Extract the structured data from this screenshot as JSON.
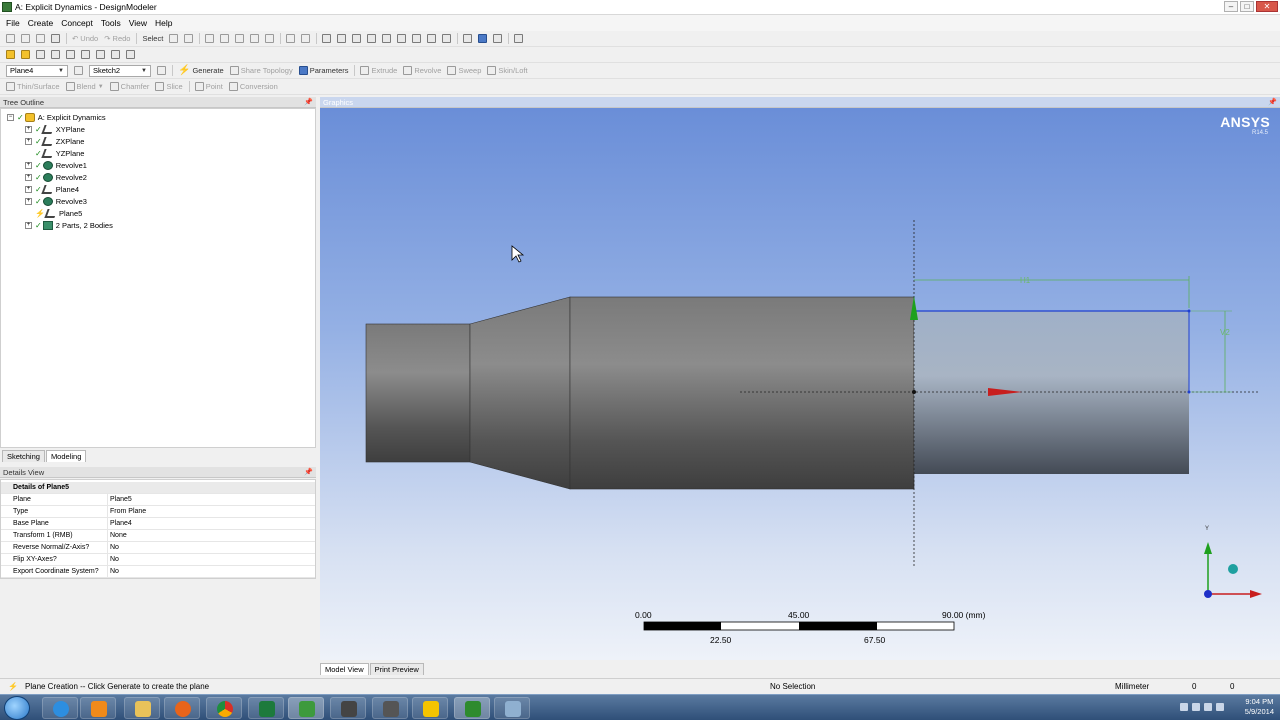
{
  "window": {
    "title": "A: Explicit Dynamics - DesignModeler"
  },
  "menu": [
    "File",
    "Create",
    "Concept",
    "Tools",
    "View",
    "Help"
  ],
  "toolbar1": {
    "undo": "Undo",
    "redo": "Redo",
    "select": "Select"
  },
  "toolbar3": {
    "plane_combo": "Plane4",
    "sketch_combo": "Sketch2",
    "generate": "Generate",
    "share_topology": "Share Topology",
    "parameters": "Parameters",
    "extrude": "Extrude",
    "revolve": "Revolve",
    "sweep": "Sweep",
    "skin_loft": "Skin/Loft"
  },
  "toolbar4": {
    "thin_surface": "Thin/Surface",
    "blend": "Blend",
    "chamfer": "Chamfer",
    "slice": "Slice",
    "point": "Point",
    "conversion": "Conversion"
  },
  "tree_outline": {
    "title": "Tree Outline",
    "root": "A: Explicit Dynamics",
    "items": [
      "XYPlane",
      "ZXPlane",
      "YZPlane",
      "Revolve1",
      "Revolve2",
      "Plane4",
      "Revolve3",
      "Plane5",
      "2 Parts, 2 Bodies"
    ]
  },
  "panel_tabs": {
    "sketching": "Sketching",
    "modeling": "Modeling"
  },
  "details": {
    "title": "Details View",
    "header": "Details of Plane5",
    "rows": [
      {
        "k": "Plane",
        "v": "Plane5"
      },
      {
        "k": "Type",
        "v": "From Plane"
      },
      {
        "k": "Base Plane",
        "v": "Plane4"
      },
      {
        "k": "Transform 1 (RMB)",
        "v": "None"
      },
      {
        "k": "Reverse Normal/Z-Axis?",
        "v": "No"
      },
      {
        "k": "Flip XY-Axes?",
        "v": "No"
      },
      {
        "k": "Export Coordinate System?",
        "v": "No"
      }
    ]
  },
  "graphics": {
    "title": "Graphics",
    "brand": "ANSYS",
    "version": "R14.5",
    "dim_h": "H1",
    "dim_v": "V2",
    "scale": {
      "labels_top": [
        "0.00",
        "45.00",
        "90.00 (mm)"
      ],
      "labels_bottom": [
        "22.50",
        "67.50"
      ]
    },
    "triad": {
      "y": "Y"
    }
  },
  "graphics_tabs": {
    "model_view": "Model View",
    "print_preview": "Print Preview"
  },
  "status": {
    "message": "Plane Creation -- Click Generate to create the plane",
    "selection": "No Selection",
    "units": "Millimeter",
    "v1": "0",
    "v2": "0"
  },
  "clock": {
    "time": "9:04 PM",
    "date": "5/9/2014"
  },
  "colors": {
    "accent_blue": "#4b79c6",
    "viewport_top": "#6a8ed8",
    "axis_green": "#1ea01e",
    "axis_red": "#c81e1e"
  }
}
